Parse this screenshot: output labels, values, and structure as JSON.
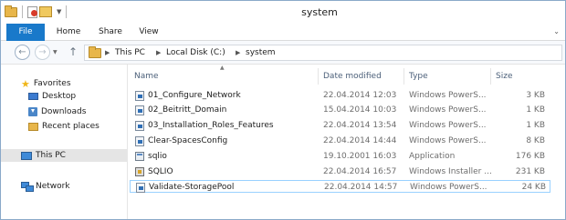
{
  "window": {
    "title": "system"
  },
  "ribbon": {
    "tabs": [
      {
        "label": "File"
      },
      {
        "label": "Home"
      },
      {
        "label": "Share"
      },
      {
        "label": "View"
      }
    ]
  },
  "address": {
    "crumbs": [
      "This PC",
      "Local Disk (C:)",
      "system"
    ]
  },
  "navpane": {
    "items": [
      {
        "label": "Favorites",
        "icon": "star-icon"
      },
      {
        "label": "Desktop",
        "icon": "desktop-icon"
      },
      {
        "label": "Downloads",
        "icon": "downloads-icon"
      },
      {
        "label": "Recent places",
        "icon": "recent-places-icon"
      },
      {
        "label": "This PC",
        "icon": "computer-icon"
      },
      {
        "label": "Network",
        "icon": "network-icon"
      }
    ]
  },
  "columns": {
    "name": "Name",
    "date": "Date modified",
    "type": "Type",
    "size": "Size"
  },
  "files": [
    {
      "name": "01_Configure_Network",
      "date": "22.04.2014 12:03",
      "type": "Windows PowerS...",
      "size": "3 KB",
      "icon": "powershell-script-icon"
    },
    {
      "name": "02_Beitritt_Domain",
      "date": "15.04.2014 10:03",
      "type": "Windows PowerS...",
      "size": "1 KB",
      "icon": "powershell-script-icon"
    },
    {
      "name": "03_Installation_Roles_Features",
      "date": "22.04.2014 13:54",
      "type": "Windows PowerS...",
      "size": "1 KB",
      "icon": "powershell-script-icon"
    },
    {
      "name": "Clear-SpacesConfig",
      "date": "22.04.2014 14:44",
      "type": "Windows PowerS...",
      "size": "8 KB",
      "icon": "powershell-script-icon"
    },
    {
      "name": "sqlio",
      "date": "19.10.2001 16:03",
      "type": "Application",
      "size": "176 KB",
      "icon": "application-icon"
    },
    {
      "name": "SQLIO",
      "date": "22.04.2014 16:57",
      "type": "Windows Installer ...",
      "size": "231 KB",
      "icon": "installer-icon"
    },
    {
      "name": "Validate-StoragePool",
      "date": "22.04.2014 14:57",
      "type": "Windows PowerS...",
      "size": "24 KB",
      "icon": "powershell-script-icon",
      "selected": true
    }
  ]
}
